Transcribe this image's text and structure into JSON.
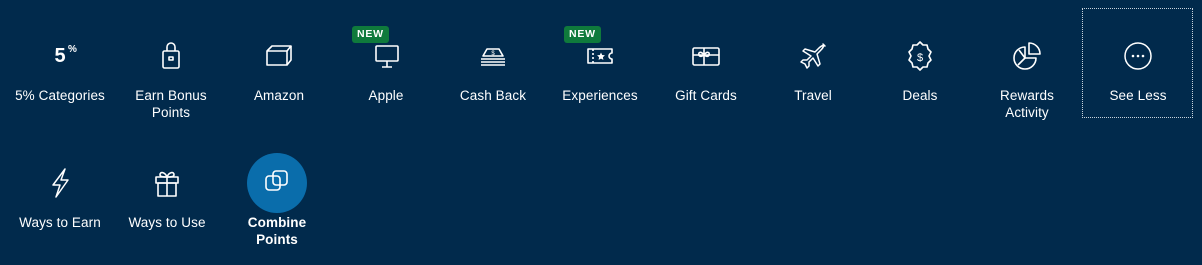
{
  "row1": [
    {
      "label": "5% Categories",
      "icon": "five-percent-icon"
    },
    {
      "label": "Earn Bonus\nPoints",
      "icon": "shopping-bag-icon"
    },
    {
      "label": "Amazon",
      "icon": "box-icon"
    },
    {
      "label": "Apple",
      "icon": "monitor-icon",
      "badge": "NEW"
    },
    {
      "label": "Cash Back",
      "icon": "cash-stack-icon"
    },
    {
      "label": "Experiences",
      "icon": "ticket-icon",
      "badge": "NEW"
    },
    {
      "label": "Gift Cards",
      "icon": "gift-card-icon"
    },
    {
      "label": "Travel",
      "icon": "airplane-icon"
    },
    {
      "label": "Deals",
      "icon": "dollar-badge-icon"
    },
    {
      "label": "Rewards\nActivity",
      "icon": "pie-chart-icon"
    },
    {
      "label": "See Less",
      "icon": "more-dots-icon"
    }
  ],
  "row2": [
    {
      "label": "Ways to Earn",
      "icon": "lightning-icon"
    },
    {
      "label": "Ways to Use",
      "icon": "gift-icon"
    },
    {
      "label": "Combine\nPoints",
      "icon": "combine-squares-icon",
      "active": true
    }
  ],
  "colors": {
    "background": "#012a4c",
    "badge": "#0f7a3c",
    "active": "#0a6dab"
  }
}
